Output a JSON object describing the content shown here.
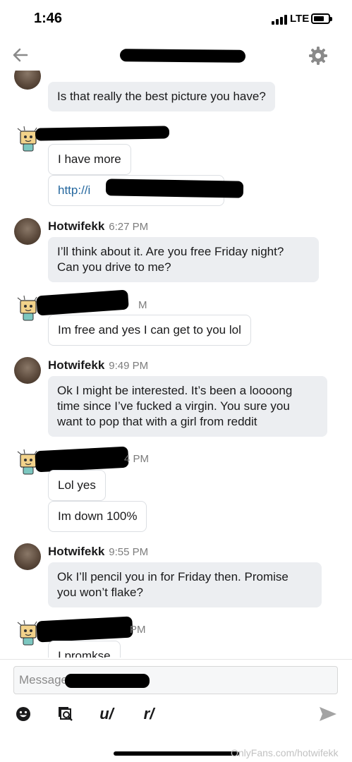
{
  "status_bar": {
    "time": "1:46",
    "network": "LTE"
  },
  "nav": {
    "back_icon": "back-arrow-icon",
    "settings_icon": "gear-icon"
  },
  "messages": [
    {
      "sender": "",
      "time": "",
      "text": "Is that really the best picture you have?"
    },
    {
      "sender": "",
      "time": "",
      "text": "I have more"
    },
    {
      "sender": "",
      "time": "",
      "text": "http://i"
    },
    {
      "sender": "Hotwifekk",
      "time": "6:27 PM",
      "lines": [
        "I’ll think about it. Are you free Friday night?",
        "Can you drive to me?"
      ]
    },
    {
      "sender": "",
      "time": "M",
      "text": "Im free and yes I can get to you lol"
    },
    {
      "sender": "Hotwifekk",
      "time": "9:49 PM",
      "lines": [
        "Ok I might be interested. It’s been a loooong",
        "time since I’ve fucked a virgin. You sure you",
        "want to pop that with a girl from reddit"
      ]
    },
    {
      "sender": "",
      "time": "4 PM",
      "text": "Lol yes"
    },
    {
      "sender": "",
      "time": "",
      "text": "Im down 100%"
    },
    {
      "sender": "Hotwifekk",
      "time": "9:55 PM",
      "lines": [
        "Ok I’ll pencil you in for Friday then. Promise",
        "you won’t flake?"
      ]
    },
    {
      "sender": "",
      "time": "PM",
      "text": "I promkse"
    }
  ],
  "composer": {
    "placeholder": "Message",
    "tools": [
      {
        "icon": "emoji-icon"
      },
      {
        "icon": "image-search-icon"
      },
      {
        "label": "u/"
      },
      {
        "label": "r/"
      }
    ],
    "send_icon": "send-icon"
  },
  "watermark": "OnlyFans.com/hotwifekk",
  "colors": {
    "bubble": "#eceef1",
    "link": "#24679e",
    "timestamp": "#7c7c7c"
  }
}
